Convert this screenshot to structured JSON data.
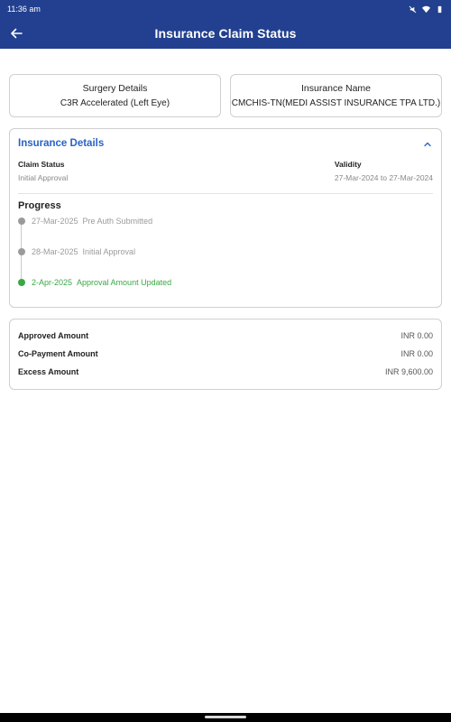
{
  "status_bar": {
    "time": "11:36",
    "time_suffix": "am"
  },
  "app_bar": {
    "title": "Insurance Claim Status"
  },
  "surgery": {
    "label": "Surgery Details",
    "value": "C3R Accelerated (Left Eye)"
  },
  "insurance": {
    "label": "Insurance Name",
    "value": "CMCHIS-TN(MEDI ASSIST INSURANCE TPA LTD.)"
  },
  "insurance_details": {
    "title": "Insurance Details",
    "claim_status_label": "Claim Status",
    "claim_status_value": "Initial Approval",
    "validity_label": "Validity",
    "validity_value": "27-Mar-2024 to 27-Mar-2024",
    "progress_title": "Progress",
    "steps": [
      {
        "date": "27-Mar-2025",
        "text": "Pre Auth Submitted"
      },
      {
        "date": "28-Mar-2025",
        "text": "Initial Approval"
      },
      {
        "date": "2-Apr-2025",
        "text": "Approval Amount Updated"
      }
    ]
  },
  "amounts": [
    {
      "label": "Approved Amount",
      "value": "INR 0.00"
    },
    {
      "label": "Co-Payment Amount",
      "value": "INR 0.00"
    },
    {
      "label": "Excess Amount",
      "value": "INR 9,600.00"
    }
  ],
  "colors": {
    "primary": "#22408f",
    "link": "#2a63c4",
    "success": "#3aa845",
    "muted": "#9b9b9b"
  },
  "icons": {
    "back": "arrow-left-icon",
    "collapse": "chevron-up-icon",
    "mute": "mute-icon",
    "wifi": "wifi-icon",
    "battery": "battery-icon"
  }
}
